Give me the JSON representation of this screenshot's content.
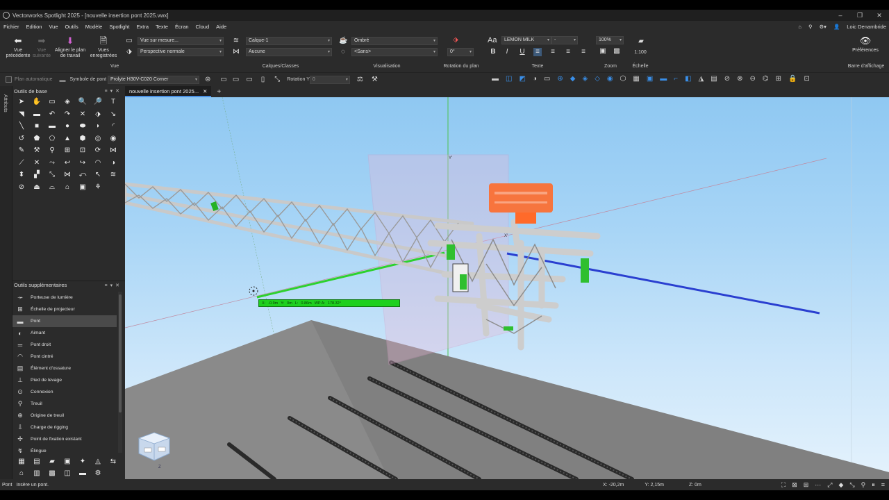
{
  "window": {
    "title": "Vectorworks Spotlight 2025 - [nouvelle insertion pont 2025.vwx]",
    "controls": [
      "–",
      "❐",
      "✕"
    ]
  },
  "menu": {
    "items": [
      "Fichier",
      "Edition",
      "Vue",
      "Outils",
      "Modèle",
      "Spotlight",
      "Extra",
      "Texte",
      "Écran",
      "Cloud",
      "Aide"
    ],
    "user": "Loic Denambride"
  },
  "ribbon": {
    "vue_precedente": "Vue précédente",
    "vue_suivante": "Vue suivante",
    "aligner": "Aligner le plan de travail",
    "vues_enregistrees": "Vues enregistrées",
    "vue_mesure": "Vue sur mesure...",
    "perspective": "Perspective normale",
    "vue_group": "Vue",
    "calque": "Calque-1",
    "classe": "Aucune",
    "calques_group": "Calques/Classes",
    "rendu": "Ombré",
    "rendu2": "<Sans>",
    "visualisation_group": "Visualisation",
    "rotation_value": "0°",
    "rotation_group": "Rotation du plan",
    "font": "LEMON MILK",
    "font_size": "-",
    "texte_group": "Texte",
    "zoom_value": "100%",
    "zoom_group": "Zoom",
    "scale_value": "1:100",
    "echelle_group": "Échelle",
    "preferences": "Préférences",
    "barre_group": "Barre d'affichage"
  },
  "modebar": {
    "plan_auto": "Plan automatique",
    "symbole_label": "Symbole de pont",
    "symbole_value": "Prolyte H30V-C020 Corner",
    "rotation_label": "Rotation Y",
    "rotation_value": "0"
  },
  "leftpanel": {
    "strip_label": "Attributs",
    "outils_base": "Outils de base",
    "outils_supp": "Outils supplémentaires",
    "tools": [
      {
        "icon": "➤",
        "name": "selection-icon"
      },
      {
        "icon": "✋",
        "name": "pan-icon"
      },
      {
        "icon": "▭",
        "name": "flyover-icon"
      },
      {
        "icon": "◈",
        "name": "walkthrough-icon"
      },
      {
        "icon": "🔍",
        "name": "zoom-icon"
      },
      {
        "icon": "🔎",
        "name": "zoom-out-icon"
      },
      {
        "icon": "T",
        "name": "text-icon"
      },
      {
        "icon": "◥",
        "name": "callout-icon"
      },
      {
        "icon": "▬",
        "name": "dimension-icon"
      },
      {
        "icon": "↶",
        "name": "arc-dim-icon"
      },
      {
        "icon": "↷",
        "name": "angle-dim-icon"
      },
      {
        "icon": "✕",
        "name": "locus-icon"
      },
      {
        "icon": "⬗",
        "name": "3d-locus-icon"
      },
      {
        "icon": "↘",
        "name": "line-icon"
      },
      {
        "icon": "╲",
        "name": "double-line-icon"
      },
      {
        "icon": "■",
        "name": "rectangle-icon"
      },
      {
        "icon": "▬",
        "name": "rounded-rect-icon"
      },
      {
        "icon": "●",
        "name": "circle-icon"
      },
      {
        "icon": "⬬",
        "name": "oval-icon"
      },
      {
        "icon": "◗",
        "name": "arc-icon"
      },
      {
        "icon": "◜",
        "name": "quarter-arc-icon"
      },
      {
        "icon": "↺",
        "name": "freehand-icon"
      },
      {
        "icon": "⬟",
        "name": "polyline-icon"
      },
      {
        "icon": "⬠",
        "name": "polygon-icon"
      },
      {
        "icon": "▲",
        "name": "regular-polygon-icon"
      },
      {
        "icon": "⬢",
        "name": "double-polygon-icon"
      },
      {
        "icon": "◎",
        "name": "spiral-icon"
      },
      {
        "icon": "◉",
        "name": "target-icon"
      },
      {
        "icon": "✎",
        "name": "pen-icon"
      },
      {
        "icon": "⚒",
        "name": "tools-icon"
      },
      {
        "icon": "⚲",
        "name": "eyedropper-icon"
      },
      {
        "icon": "⊞",
        "name": "mirror-icon"
      },
      {
        "icon": "⊡",
        "name": "rotate-icon"
      },
      {
        "icon": "⟳",
        "name": "move-icon"
      },
      {
        "icon": "⋈",
        "name": "split-icon"
      },
      {
        "icon": "⟋",
        "name": "clip-icon"
      },
      {
        "icon": "✕",
        "name": "trim-icon"
      },
      {
        "icon": "⤳",
        "name": "connect-icon"
      },
      {
        "icon": "↩",
        "name": "fillet-icon"
      },
      {
        "icon": "↪",
        "name": "chamfer-icon"
      },
      {
        "icon": "◠",
        "name": "offset-icon"
      },
      {
        "icon": "◑",
        "name": "reshape-icon"
      },
      {
        "icon": "⬍",
        "name": "attribute-icon"
      },
      {
        "icon": "▞",
        "name": "reference-icon"
      },
      {
        "icon": "⤡",
        "name": "scale-icon"
      },
      {
        "icon": "⋈",
        "name": "align-icon"
      },
      {
        "icon": "⤺",
        "name": "rotate-3d-icon"
      },
      {
        "icon": "↖",
        "name": "node-icon"
      },
      {
        "icon": "≋",
        "name": "wave-icon"
      },
      {
        "icon": "⊘",
        "name": "stop-icon"
      },
      {
        "icon": "⏏",
        "name": "section-icon"
      },
      {
        "icon": "⌓",
        "name": "viewport-icon"
      },
      {
        "icon": "⌂",
        "name": "home-icon"
      },
      {
        "icon": "▣",
        "name": "sheet-icon"
      },
      {
        "icon": "⚘",
        "name": "hatch-icon"
      }
    ],
    "tool_items": [
      {
        "icon": "⤞",
        "label": "Porteuse de lumière"
      },
      {
        "icon": "⊞",
        "label": "Échelle de projecteur"
      },
      {
        "icon": "▬",
        "label": "Pont"
      },
      {
        "icon": "◐",
        "label": "Aimant"
      },
      {
        "icon": "═",
        "label": "Pont droit"
      },
      {
        "icon": "◠",
        "label": "Pont cintré"
      },
      {
        "icon": "▤",
        "label": "Élément d'ossature"
      },
      {
        "icon": "⊥",
        "label": "Pied de levage"
      },
      {
        "icon": "⊙",
        "label": "Connexion"
      },
      {
        "icon": "⚲",
        "label": "Treuil"
      },
      {
        "icon": "⊕",
        "label": "Origine de treuil"
      },
      {
        "icon": "⇩",
        "label": "Charge de rigging"
      },
      {
        "icon": "✢",
        "label": "Point de fixation existant"
      },
      {
        "icon": "↯",
        "label": "Élingue"
      }
    ],
    "bottom_icons": [
      "▦",
      "▤",
      "▰",
      "▣",
      "✦",
      "◬",
      "⇆",
      "⌂",
      "▥",
      "▩",
      "◫",
      "▬",
      "⚙"
    ]
  },
  "tab": {
    "name": "nouvelle insertion pont 2025...",
    "close": "✕",
    "plus": "+"
  },
  "viewport": {
    "axis_y": "Y'",
    "axis_x": "X'",
    "axis_z": "Z",
    "coord_fields": [
      "X:",
      "-0.9m",
      "Y:",
      "0m",
      "L:",
      "0.86m",
      "WP A:",
      "178.32°"
    ]
  },
  "statusbar": {
    "mode": "Pont",
    "hint": "Insère un pont.",
    "x": "X: -20,2m",
    "y": "Y: 2,15m",
    "z": "Z: 0m"
  }
}
